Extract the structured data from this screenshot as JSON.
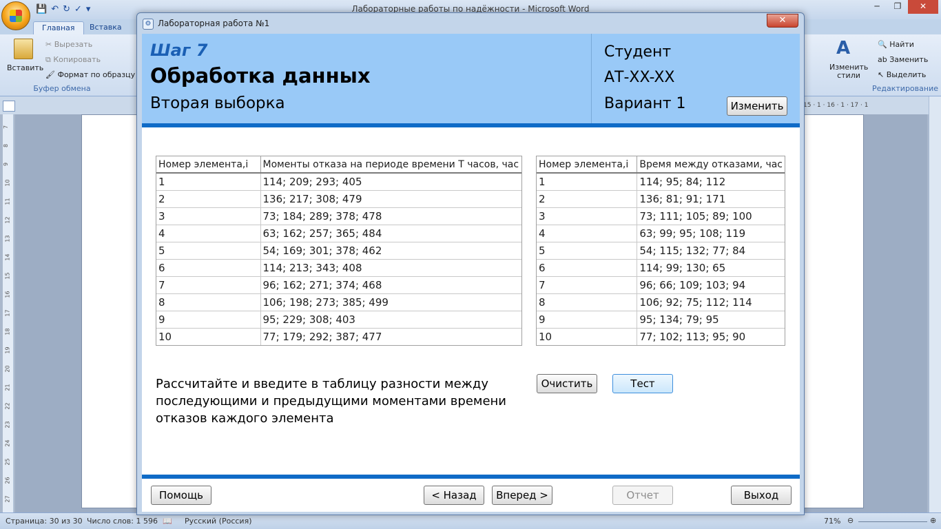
{
  "word": {
    "window_title": "Лабораторные работы по надёжности - Microsoft Word",
    "tabs": [
      "Главная",
      "Вставка"
    ],
    "ribbon": {
      "paste": "Вставить",
      "cut": "Вырезать",
      "copy": "Копировать",
      "format_painter": "Формат по образцу",
      "clipboard_group": "Буфер обмена",
      "change_styles": "Изменить стили",
      "find": "Найти",
      "replace": "Заменить",
      "select": "Выделить",
      "editing_group": "Редактирование"
    },
    "ruler_right": "15 · 1 · 16 · 1 · 17 · 1",
    "status": {
      "page": "Страница: 30 из 30",
      "words": "Число слов: 1 596",
      "language": "Русский (Россия)",
      "zoom": "71%"
    }
  },
  "dialog": {
    "title": "Лабораторная работа №1",
    "step": "Шаг 7",
    "heading": "Обработка данных",
    "subheading": "Вторая выборка",
    "student_label": "Студент",
    "group": "АТ-XX-XX",
    "variant": "Вариант 1",
    "change_button": "Изменить",
    "table1": {
      "headers": [
        "Номер элемента,i",
        "Моменты отказа на периоде времени Т часов, час"
      ],
      "rows": [
        [
          "1",
          "114; 209; 293; 405"
        ],
        [
          "2",
          "136; 217; 308; 479"
        ],
        [
          "3",
          "73; 184; 289; 378; 478"
        ],
        [
          "4",
          "63; 162; 257; 365; 484"
        ],
        [
          "5",
          "54; 169; 301; 378; 462"
        ],
        [
          "6",
          "114; 213; 343; 408"
        ],
        [
          "7",
          "96; 162; 271; 374; 468"
        ],
        [
          "8",
          "106; 198; 273; 385; 499"
        ],
        [
          "9",
          "95; 229; 308; 403"
        ],
        [
          "10",
          "77; 179; 292; 387; 477"
        ]
      ]
    },
    "table2": {
      "headers": [
        "Номер элемента,i",
        "Время между отказами, час"
      ],
      "rows": [
        [
          "1",
          "114; 95; 84; 112"
        ],
        [
          "2",
          "136; 81; 91; 171"
        ],
        [
          "3",
          "73; 111; 105; 89; 100"
        ],
        [
          "4",
          "63; 99; 95; 108; 119"
        ],
        [
          "5",
          "54; 115; 132; 77; 84"
        ],
        [
          "6",
          "114; 99; 130; 65"
        ],
        [
          "7",
          "96; 66; 109; 103; 94"
        ],
        [
          "8",
          "106; 92; 75; 112; 114"
        ],
        [
          "9",
          "95; 134; 79; 95"
        ],
        [
          "10",
          "77; 102; 113; 95; 90"
        ]
      ]
    },
    "instruction": "Рассчитайте и введите в таблицу разности между последующими и предыдущими моментами времени отказов каждого элемента",
    "clear_button": "Очистить",
    "test_button": "Тест",
    "help_button": "Помощь",
    "back_button": "< Назад",
    "next_button": "Вперед >",
    "report_button": "Отчет",
    "exit_button": "Выход"
  }
}
